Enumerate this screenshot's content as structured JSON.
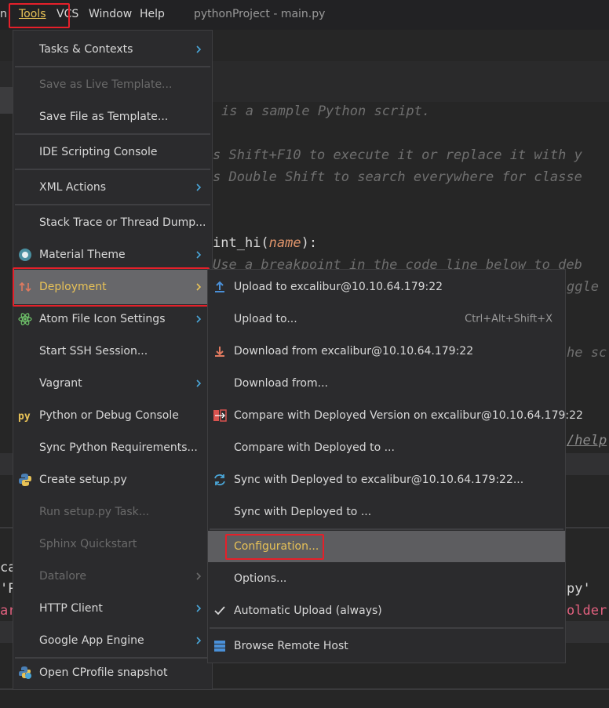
{
  "menubar": {
    "partial_left": "n",
    "tools": "Tools",
    "vcs": "VCS",
    "window": "Window",
    "help": "Help",
    "title": "pythonProject - main.py"
  },
  "editor": {
    "line1": "is a sample Python script.",
    "line2": "s Shift+F10 to execute it or replace it with y",
    "line3": "s Double Shift to search everywhere for classe",
    "def_name": "int_hi",
    "def_open": "(",
    "def_param": "name",
    "def_close": "):",
    "line5": "Use a breakpoint in the code line below to deb",
    "line6": "ggle",
    "line7": "he sc",
    "line8": "/help",
    "bottom1": "ca",
    "bottom2": "'P",
    "bottom2b": "py'",
    "bottom3": "ar",
    "bottom3b": "older"
  },
  "tools_menu": {
    "items": [
      {
        "label": "Tasks & Contexts",
        "submenu": true,
        "disabled": false
      },
      {
        "label": "Save as Live Template...",
        "disabled": true
      },
      {
        "label": "Save File as Template...",
        "disabled": false
      },
      {
        "label": "IDE Scripting Console",
        "disabled": false
      },
      {
        "label": "XML Actions",
        "submenu": true,
        "disabled": false
      },
      {
        "label": "Stack Trace or Thread Dump...",
        "disabled": false
      },
      {
        "label": "Material Theme",
        "submenu": true,
        "icon": "material-theme-icon"
      },
      {
        "label": "Deployment",
        "submenu": true,
        "icon": "deployment-icon",
        "highlighted": true
      },
      {
        "label": "Atom File Icon Settings",
        "submenu": true,
        "icon": "atom-icon"
      },
      {
        "label": "Start SSH Session...",
        "disabled": false
      },
      {
        "label": "Vagrant",
        "submenu": true
      },
      {
        "label": "Python or Debug Console",
        "icon": "python-console-icon"
      },
      {
        "label": "Sync Python Requirements..."
      },
      {
        "label": "Create setup.py",
        "icon": "python-logo-icon"
      },
      {
        "label": "Run setup.py Task...",
        "disabled": true
      },
      {
        "label": "Sphinx Quickstart",
        "disabled": true
      },
      {
        "label": "Datalore",
        "submenu": true,
        "disabled": true
      },
      {
        "label": "HTTP Client",
        "submenu": true
      },
      {
        "label": "Google App Engine",
        "submenu": true
      },
      {
        "label": "Open CProfile snapshot",
        "icon": "cprofile-icon"
      }
    ]
  },
  "deploy_menu": {
    "items": [
      {
        "label": "Upload to excalibur@10.10.64.179:22",
        "icon": "upload-icon"
      },
      {
        "label": "Upload to...",
        "shortcut": "Ctrl+Alt+Shift+X"
      },
      {
        "label": "Download from excalibur@10.10.64.179:22",
        "icon": "download-icon"
      },
      {
        "label": "Download from..."
      },
      {
        "label": "Compare with Deployed Version on excalibur@10.10.64.179:22",
        "icon": "compare-icon"
      },
      {
        "label": "Compare with Deployed to ..."
      },
      {
        "label": "Sync with Deployed to excalibur@10.10.64.179:22...",
        "icon": "sync-icon"
      },
      {
        "label": "Sync with Deployed to ..."
      },
      {
        "label": "Configuration...",
        "highlighted": true
      },
      {
        "label": "Options..."
      },
      {
        "label": "Automatic Upload (always)",
        "icon": "checkmark-icon"
      },
      {
        "label": "Browse Remote Host",
        "icon": "remote-host-icon"
      }
    ]
  },
  "colors": {
    "accent_red": "#e5202a",
    "highlight_yellow": "#e8c257",
    "menu_bg": "#2b2b2d"
  }
}
